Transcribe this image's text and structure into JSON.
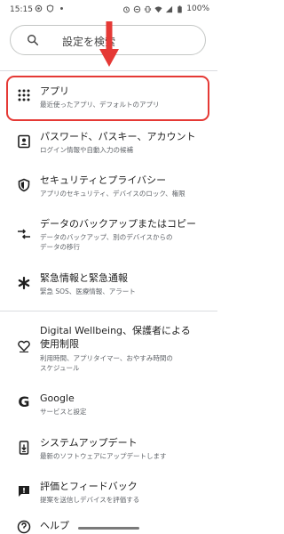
{
  "status_bar": {
    "time": "15:15",
    "battery": "100%"
  },
  "search": {
    "placeholder": "設定を検索"
  },
  "items": [
    {
      "title": "アプリ",
      "subtitle": "最近使ったアプリ、デフォルトのアプリ",
      "icon": "apps-grid-icon"
    },
    {
      "title": "パスワード、パスキー、アカウント",
      "subtitle": "ログイン情報や自動入力の候補",
      "icon": "account-box-icon"
    },
    {
      "title": "セキュリティとプライバシー",
      "subtitle": "アプリのセキュリティ、デバイスのロック、権限",
      "icon": "shield-icon"
    },
    {
      "title": "データのバックアップまたはコピー",
      "subtitle_line1": "データのバックアップ、別のデバイスからの",
      "subtitle_line2": "データの移行",
      "icon": "transfer-arrows-icon"
    },
    {
      "title": "緊急情報と緊急通報",
      "subtitle": "緊急 SOS、医療情報、アラート",
      "icon": "asterisk-icon"
    },
    {
      "title_line1": "Digital Wellbeing、保護者による",
      "title_line2": "使用制限",
      "subtitle_line1": "利用時間、アプリタイマー、おやすみ時間の",
      "subtitle_line2": "スケジュール",
      "icon": "wellbeing-icon"
    },
    {
      "title": "Google",
      "subtitle": "サービスと設定",
      "icon": "google-g-icon"
    },
    {
      "title": "システムアップデート",
      "subtitle": "最新のソフトウェアにアップデートします",
      "icon": "system-update-icon"
    },
    {
      "title": "評価とフィードバック",
      "subtitle": "提案を送信しデバイスを評価する",
      "icon": "feedback-icon"
    },
    {
      "title": "ヘルプ",
      "icon": "help-icon"
    }
  ],
  "colors": {
    "highlight": "#e53935",
    "arrow": "#e53935",
    "divider": "#dadce0"
  }
}
